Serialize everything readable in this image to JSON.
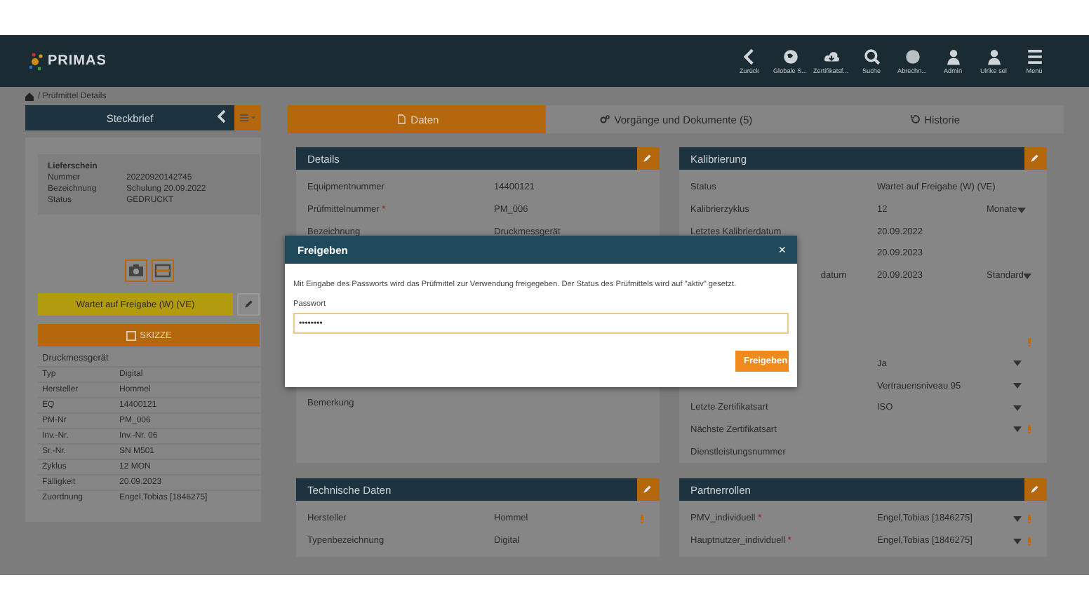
{
  "header": {
    "logo": "PRIMAS",
    "nav": [
      {
        "label": "Zurück",
        "kind": "back"
      },
      {
        "label": "Globale S...",
        "kind": "globe"
      },
      {
        "label": "Zertifikatsf...",
        "kind": "cloud"
      },
      {
        "label": "Suche",
        "kind": "search"
      },
      {
        "label": "Abrechn...",
        "kind": "circle"
      },
      {
        "label": "Admin",
        "kind": "person"
      },
      {
        "label": "Ulrike sel",
        "kind": "person"
      },
      {
        "label": "Menü",
        "kind": "menu"
      }
    ]
  },
  "breadcrumb": {
    "separator": "/",
    "label": "Prüfmittel Details"
  },
  "sidebar": {
    "title": "Steckbrief",
    "delivery": {
      "title": "Lieferschein",
      "rows": [
        {
          "label": "Nummer",
          "value": "20220920142745"
        },
        {
          "label": "Bezeichnung",
          "value": "Schulung 20.09.2022"
        },
        {
          "label": "Status",
          "value": "GEDRUCKT"
        }
      ]
    },
    "status_button": "Wartet auf Freigabe (W) (VE)",
    "sketch_button": "SKIZZE",
    "device_title": "Druckmessgerät",
    "device_rows": [
      {
        "label": "Typ",
        "value": "Digital"
      },
      {
        "label": "Hersteller",
        "value": "Hommel"
      },
      {
        "label": "EQ",
        "value": "14400121"
      },
      {
        "label": "PM-Nr",
        "value": "PM_006"
      },
      {
        "label": "Inv.-Nr.",
        "value": "Inv.-Nr. 06"
      },
      {
        "label": "Sr.-Nr.",
        "value": "SN M501"
      },
      {
        "label": "Zyklus",
        "value": "12 MON"
      },
      {
        "label": "Fälligkeit",
        "value": "20.09.2023"
      },
      {
        "label": "Zuordnung",
        "value": "Engel,Tobias [1846275]"
      }
    ]
  },
  "tabs": [
    {
      "label": "Daten",
      "kind": "doc",
      "selected": true
    },
    {
      "label": "Vorgänge und Dokumente (5)",
      "kind": "gears",
      "selected": false
    },
    {
      "label": "Historie",
      "kind": "history",
      "selected": false
    }
  ],
  "panels": [
    {
      "title": "Details",
      "rows": [
        {
          "kind": "field",
          "label": "Equipmentnummer",
          "value": "14400121",
          "dropdown": false,
          "warning": false
        },
        {
          "kind": "field",
          "label": "Prüfmittelnummer",
          "required_mark": "*",
          "value": "PM_006",
          "dropdown": false,
          "warning": false
        },
        {
          "kind": "field",
          "label": "Bezeichnung",
          "value": "Druckmessgerät",
          "dropdown": false,
          "warning": false
        },
        {
          "kind": "textarea",
          "label": "Bemerkung",
          "dropdown": false,
          "warning": false
        }
      ]
    },
    {
      "title": "Kalibrierung",
      "rows": [
        {
          "kind": "field",
          "label": "Status",
          "value": "Wartet auf Freigabe (W) (VE)",
          "dropdown": false,
          "warning": false
        },
        {
          "kind": "field",
          "label": "Kalibrierzyklus",
          "value": "12",
          "extra": "Monate",
          "dropdown": true,
          "warning": false
        },
        {
          "kind": "field",
          "label": "Letztes Kalibrierdatum",
          "value": "20.09.2022",
          "dropdown": false,
          "warning": false
        },
        {
          "kind": "field",
          "value": "20.09.2023",
          "dropdown": false,
          "warning": false
        },
        {
          "kind": "field",
          "label": "datum",
          "value": "20.09.2023",
          "extra": "Standard",
          "dropdown": true,
          "warning": false
        },
        {
          "kind": "field",
          "dropdown": false,
          "warning": false
        },
        {
          "kind": "field",
          "dropdown": false,
          "warning": false
        },
        {
          "kind": "field",
          "dropdown": false,
          "warning": true
        },
        {
          "kind": "field",
          "value": "Ja",
          "dropdown": true,
          "warning": false
        },
        {
          "kind": "field",
          "value": "Vertrauensniveau 95",
          "dropdown": true,
          "warning": false
        },
        {
          "kind": "field",
          "label": "Letzte Zertifikatsart",
          "value": "ISO",
          "dropdown": true,
          "warning": false
        },
        {
          "kind": "field",
          "label": "Nächste Zertifikatsart",
          "dropdown": true,
          "warning": true
        },
        {
          "kind": "field",
          "label": "Dienstleistungsnummer",
          "dropdown": false,
          "warning": false
        }
      ]
    },
    {
      "title": "Technische Daten",
      "rows": [
        {
          "kind": "field",
          "label": "Hersteller",
          "value": "Hommel",
          "dropdown": false,
          "warning": true
        },
        {
          "kind": "field",
          "label": "Typenbezeichnung",
          "value": "Digital",
          "dropdown": false,
          "warning": false
        }
      ]
    },
    {
      "title": "Partnerrollen",
      "rows": [
        {
          "kind": "field",
          "label": "PMV_individuell",
          "required_mark": "*",
          "value": "Engel,Tobias [1846275]",
          "dropdown": true,
          "warning": true
        },
        {
          "kind": "field",
          "label": "Hauptnutzer_individuell",
          "required_mark": "*",
          "value": "Engel,Tobias [1846275]",
          "dropdown": true,
          "warning": true
        }
      ]
    }
  ],
  "dialog": {
    "title": "Freigeben",
    "close": "×",
    "message": "Mit Eingabe des Passworts wird das Prüfmittel zur Verwendung freigegeben. Der Status des Prüfmittels wird auf \"aktiv\" gesetzt.",
    "field_label": "Passwort",
    "password": "••••••••",
    "button": "Freigeben"
  }
}
